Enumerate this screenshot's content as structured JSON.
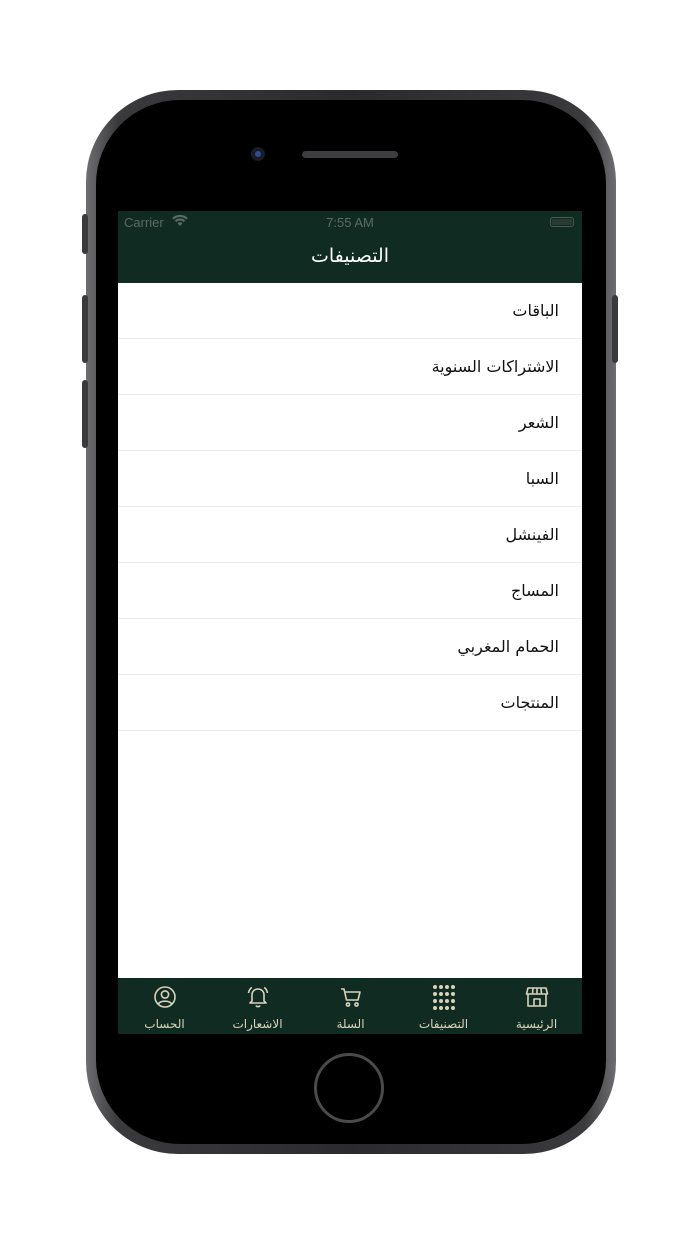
{
  "status_bar": {
    "carrier": "Carrier",
    "time": "7:55 AM"
  },
  "header": {
    "title": "التصنيفات"
  },
  "categories": [
    "الباقات",
    "الاشتراكات السنوية",
    "الشعر",
    "السبا",
    "الفينشل",
    "المساج",
    "الحمام المغربي",
    "المنتجات"
  ],
  "tabbar": {
    "account": "الحساب",
    "notifications": "الاشعارات",
    "cart": "السلة",
    "categories": "التصنيفات",
    "home": "الرئيسية"
  },
  "colors": {
    "header_bg": "#0f2b22",
    "tab_icon": "#d9d3bb"
  }
}
